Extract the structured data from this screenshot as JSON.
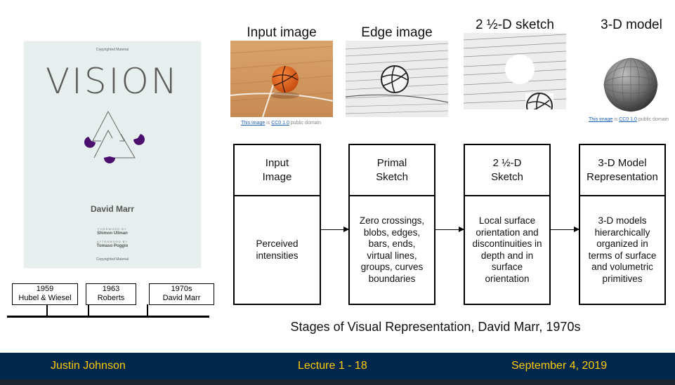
{
  "book": {
    "copyright_top": "Copyrighted Material",
    "title": "VISION",
    "author": "David Marr",
    "foreword_label": "FOREWORD BY",
    "foreword_name": "Shimon Ullman",
    "afterword_label": "AFTERWORD BY",
    "afterword_name": "Tomaso Poggio",
    "copyright_bottom": "Copyrighted Material"
  },
  "timeline": [
    {
      "year": "1959",
      "label": "Hubel & Wiesel"
    },
    {
      "year": "1963",
      "label": "Roberts"
    },
    {
      "year": "1970s",
      "label": "David Marr"
    }
  ],
  "images": {
    "input_label": "Input image",
    "edge_label": "Edge image",
    "sketch_label": "2 ½-D sketch",
    "model_label": "3-D model",
    "credit1": {
      "link": "This image",
      "is": " is ",
      "license": "CC0 1.0",
      "rest": " public domain"
    },
    "credit2": {
      "link": "This image",
      "is": " is ",
      "license": "CC0 1.0",
      "rest": " public domain"
    }
  },
  "stages": [
    {
      "head": "Input\nImage",
      "body": "Perceived\nintensities"
    },
    {
      "head": "Primal\nSketch",
      "body": "Zero crossings,\nblobs, edges,\nbars, ends,\nvirtual lines,\ngroups, curves\nboundaries"
    },
    {
      "head": "2 ½-D\nSketch",
      "body": "Local surface\norientation and\ndiscontinuities in\ndepth and in\nsurface\norientation"
    },
    {
      "head": "3-D Model\nRepresentation",
      "body": "3-D models\nhierarchically\norganized in\nterms of surface\nand volumetric\nprimitives"
    }
  ],
  "caption": "Stages of Visual Representation, David Marr, 1970s",
  "footer": {
    "presenter": "Justin Johnson",
    "lecture": "Lecture 1 - 18",
    "date": "September 4, 2019"
  },
  "colors": {
    "footer_bg": "#00274c",
    "footer_text": "#ffcb05",
    "book_bg": "#e7eeee",
    "book_accent": "#4b0f6e",
    "ball": "#e8631c"
  }
}
